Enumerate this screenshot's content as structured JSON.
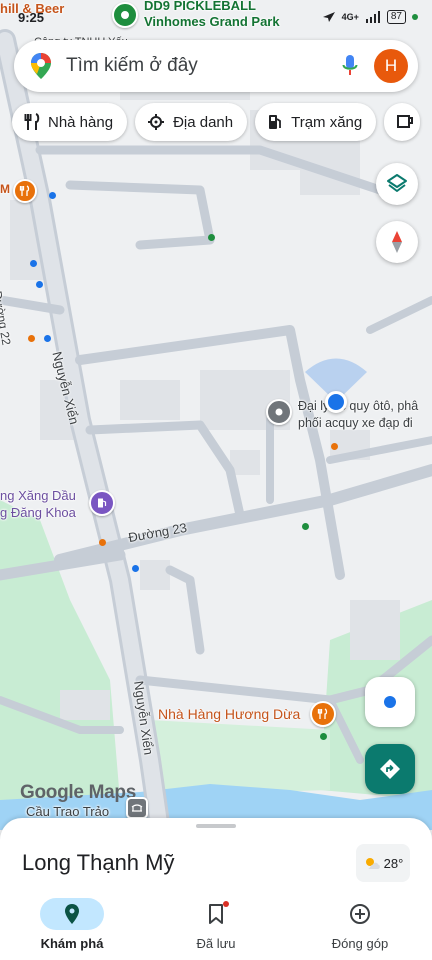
{
  "status_bar": {
    "time": "9:25",
    "network": "4G+",
    "battery": "87"
  },
  "search": {
    "placeholder": "Tìm kiếm ở đây",
    "avatar_letter": "H"
  },
  "chips": [
    {
      "label": "Nhà hàng",
      "icon": "fork-knife-icon"
    },
    {
      "label": "Địa danh",
      "icon": "landmark-icon"
    },
    {
      "label": "Trạm xăng",
      "icon": "gas-station-icon"
    }
  ],
  "map": {
    "pois": {
      "pickleball_line1": "DD9 PICKLEBALL",
      "pickleball_line2": "Vinhomes Grand Park",
      "chill_beer": "hill & Beer",
      "company": "Công ty TNHH Yếu",
      "dai_ly_line1": "Đại lý ắc quy ôtô, phâ",
      "dai_ly_line2": "phối acquy xe đạp đi",
      "gas_line1": "ng Xăng Dầu",
      "gas_line2": "g Đăng Khoa",
      "restaurant": "Nhà Hàng Hương Dừa",
      "bridge": "Cầu Trao Trảo"
    },
    "streets": {
      "nguyen_xien_1": "Nguyễn Xiển",
      "nguyen_xien_2": "Nguyễn Xiển",
      "duong_23": "Đường 23",
      "duong_22": "Đường 22"
    },
    "logo": "Google Maps",
    "colors": {
      "road": "#c6cdd6",
      "water": "#9fd3f5",
      "park": "#c8ecd3",
      "accent_blue": "#1a73e8",
      "poi_orange": "#e8710a",
      "teal": "#0b7a6e"
    }
  },
  "sheet": {
    "title": "Long Thạnh Mỹ",
    "temperature": "28°"
  },
  "nav": [
    {
      "label": "Khám phá",
      "icon": "explore-pin-icon",
      "active": true
    },
    {
      "label": "Đã lưu",
      "icon": "bookmark-icon",
      "active": false
    },
    {
      "label": "Đóng góp",
      "icon": "add-circle-icon",
      "active": false
    }
  ]
}
